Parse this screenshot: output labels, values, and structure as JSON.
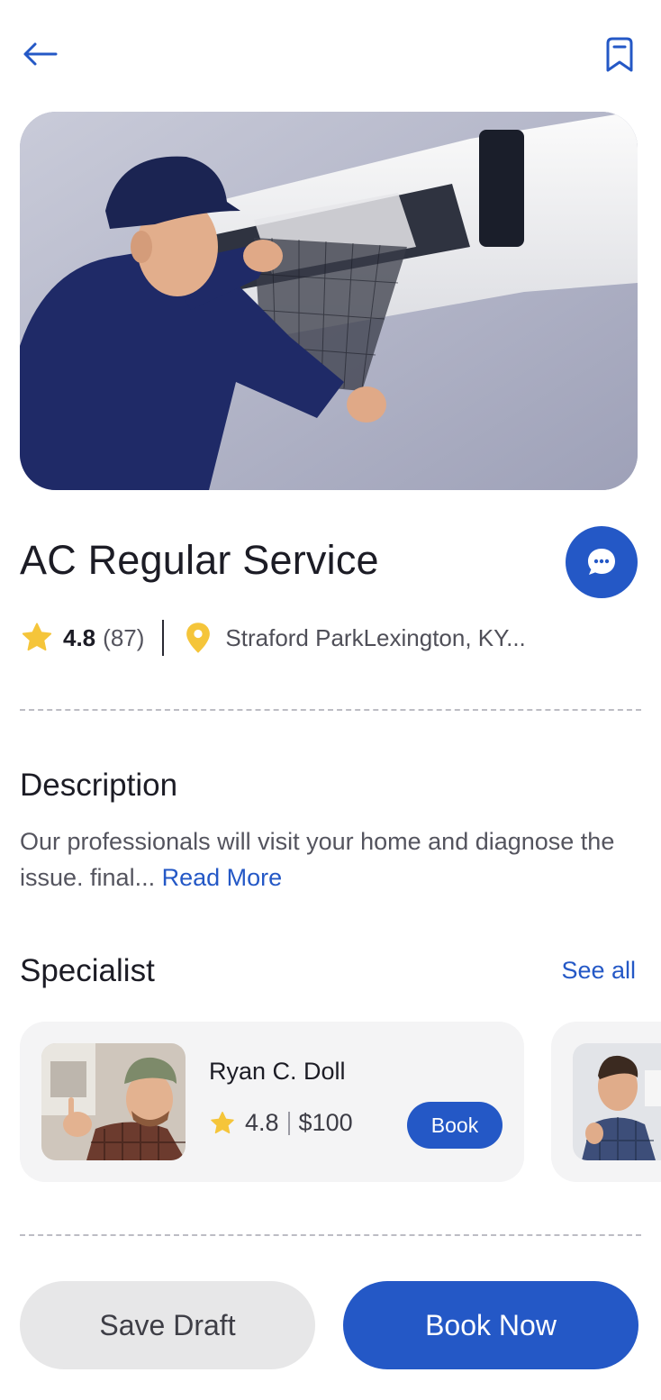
{
  "header": {
    "back_icon": "arrow-left-icon",
    "bookmark_icon": "bookmark-icon"
  },
  "hero": {
    "image_subject": "technician-cleaning-ac-filter-photo"
  },
  "service": {
    "title": "AC Regular Service",
    "rating": "4.8",
    "review_count": "(87)",
    "location": "Straford ParkLexington, KY...",
    "chat_icon": "chat-bubble-icon"
  },
  "description": {
    "heading": "Description",
    "text": "Our professionals will visit your home and diagnose the issue. final... ",
    "read_more": "Read More"
  },
  "specialist": {
    "heading": "Specialist",
    "see_all": "See all",
    "items": [
      {
        "name": "Ryan C. Doll",
        "rating": "4.8",
        "price": "$100",
        "book_label": "Book"
      }
    ]
  },
  "footer": {
    "save_draft": "Save Draft",
    "book_now": "Book Now"
  },
  "colors": {
    "primary": "#2458c6",
    "star": "#f5c53a",
    "pin": "#f5c53a",
    "surface": "#f4f4f5"
  }
}
